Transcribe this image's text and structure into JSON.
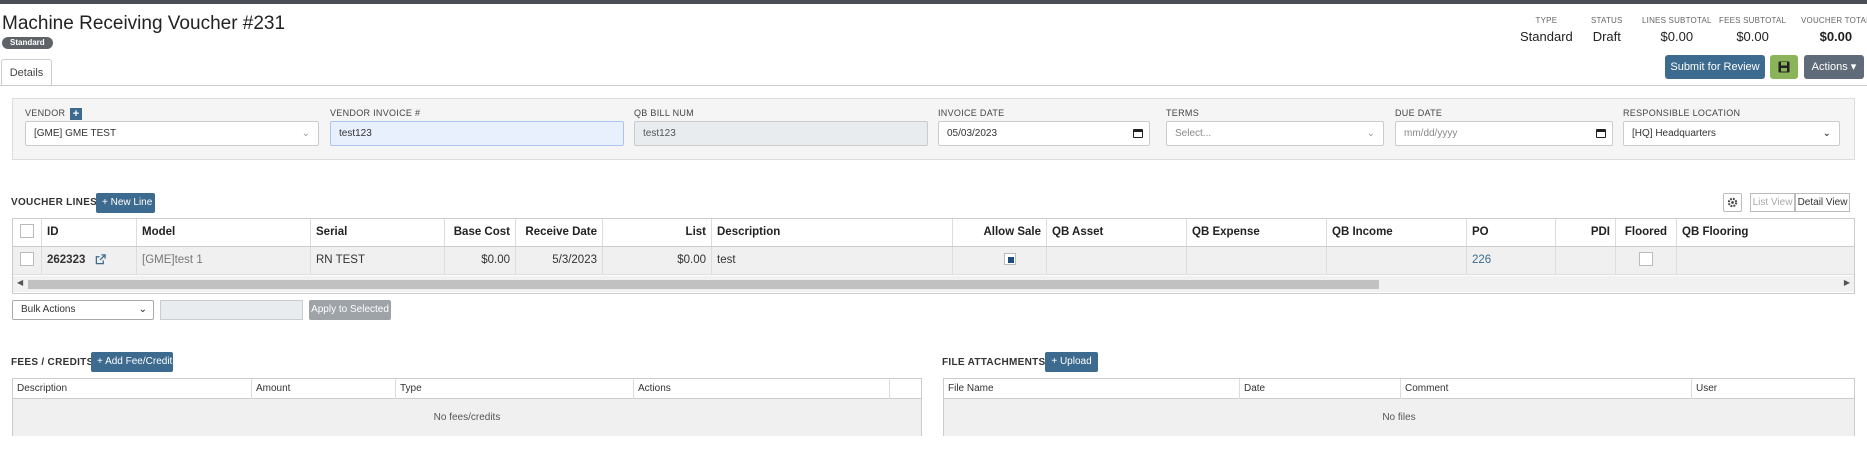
{
  "header": {
    "title": "Machine Receiving Voucher #231",
    "badge": "Standard",
    "summary": [
      {
        "label": "TYPE",
        "value": "Standard"
      },
      {
        "label": "STATUS",
        "value": "Draft"
      },
      {
        "label": "LINES SUBTOTAL",
        "value": "$0.00"
      },
      {
        "label": "FEES SUBTOTAL",
        "value": "$0.00"
      },
      {
        "label": "VOUCHER TOTAL",
        "value": "$0.00"
      }
    ],
    "submit_label": "Submit for Review",
    "actions_label": "Actions ▾"
  },
  "tabs": [
    {
      "label": "Details"
    }
  ],
  "form": {
    "vendor": {
      "label": "VENDOR",
      "value": "[GME] GME TEST"
    },
    "vendor_invoice": {
      "label": "VENDOR INVOICE #",
      "value": "test123"
    },
    "qb_bill_num": {
      "label": "QB BILL NUM",
      "value": "test123"
    },
    "invoice_date": {
      "label": "INVOICE DATE",
      "value": "05/03/2023"
    },
    "terms": {
      "label": "TERMS",
      "placeholder": "Select..."
    },
    "due_date": {
      "label": "DUE DATE",
      "placeholder": "mm/dd/yyyy"
    },
    "responsible_location": {
      "label": "RESPONSIBLE LOCATION",
      "value": "[HQ] Headquarters"
    }
  },
  "voucher_lines": {
    "title": "VOUCHER LINES",
    "new_line_label": "+ New Line",
    "list_view_label": "List View",
    "detail_view_label": "Detail View",
    "columns": [
      "ID",
      "Model",
      "Serial",
      "Base Cost",
      "Receive Date",
      "List",
      "Description",
      "Allow Sale",
      "QB Asset",
      "QB Expense",
      "QB Income",
      "PO",
      "PDI",
      "Floored",
      "QB Flooring"
    ],
    "rows": [
      {
        "id": "262323",
        "model": "[GME]test 1",
        "serial": "RN TEST",
        "base_cost": "$0.00",
        "receive_date": "5/3/2023",
        "list": "$0.00",
        "description": "test",
        "allow_sale": true,
        "qb_asset": "",
        "qb_expense": "",
        "qb_income": "",
        "po": "226",
        "pdi": "",
        "floored": false,
        "qb_flooring": ""
      }
    ],
    "bulk_actions_placeholder": "Bulk Actions",
    "apply_label": "Apply to Selected"
  },
  "fees": {
    "title": "FEES / CREDITS",
    "add_label": "+ Add Fee/Credit",
    "columns": [
      "Description",
      "Amount",
      "Type",
      "Actions"
    ],
    "empty_text": "No fees/credits"
  },
  "attachments": {
    "title": "FILE ATTACHMENTS",
    "upload_label": "+ Upload",
    "columns": [
      "File Name",
      "Date",
      "Comment",
      "User"
    ],
    "empty_text": "No files"
  },
  "colors": {
    "primary": "#3d6a8f",
    "save_green": "#8bb35a",
    "actions_gray": "#5f6b78",
    "topbar": "#4a4f57"
  }
}
